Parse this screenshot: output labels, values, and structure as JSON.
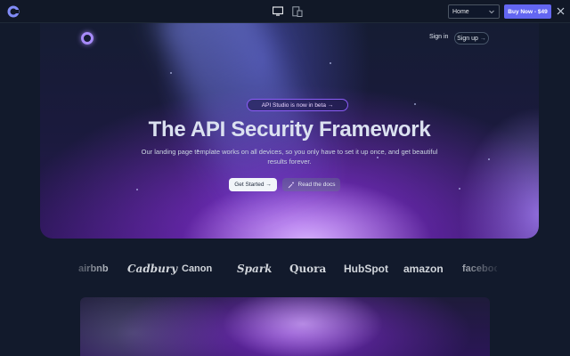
{
  "toolbar": {
    "logo_icon": "cruip-logo-icon",
    "devices": [
      "desktop-icon",
      "tablet-mobile-icon"
    ],
    "page_select_value": "Home",
    "buy_label": "Buy Now - $49",
    "close_icon": "close-icon",
    "accent": "#6366f1"
  },
  "nav": {
    "signin_label": "Sign in",
    "signup_label": "Sign up",
    "signup_arrow": "→"
  },
  "hero": {
    "announcement": "API Studio is now in beta →",
    "title": "The API Security Framework",
    "subtitle": "Our landing page template works on all devices, so you only have to set it up once, and get beautiful results forever.",
    "primary_cta": "Get Started →",
    "secondary_cta": "Read the docs",
    "accent": "#a855f7"
  },
  "logos": [
    "airbnb",
    "Cadbury",
    "Canon",
    "Spark",
    "Quora",
    "HubSpot",
    "amazon",
    "facebook"
  ]
}
